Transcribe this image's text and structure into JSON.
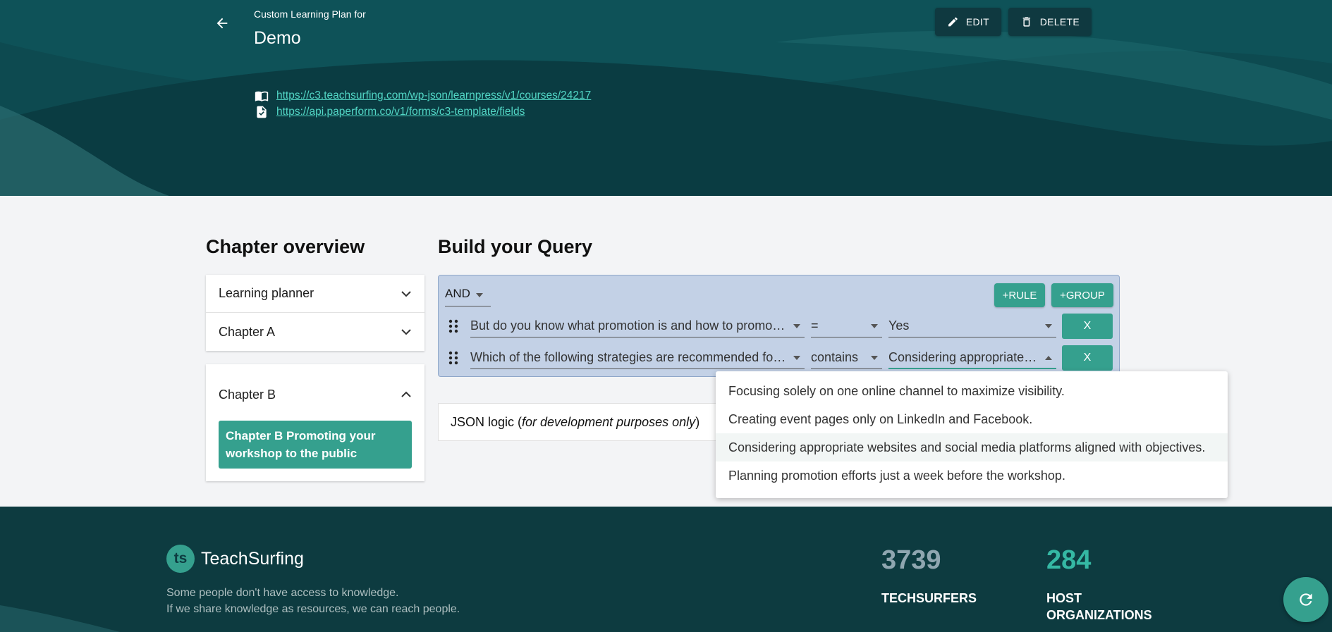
{
  "header": {
    "subtitle": "Custom Learning Plan for",
    "title": "Demo",
    "edit_label": "EDIT",
    "delete_label": "DELETE",
    "links": [
      {
        "icon": "book-icon",
        "text": "https://c3.teachsurfing.com/wp-json/learnpress/v1/courses/24217"
      },
      {
        "icon": "form-check-icon",
        "text": "https://api.paperform.co/v1/forms/c3-template/fields"
      }
    ]
  },
  "overview": {
    "title": "Chapter overview",
    "items": [
      {
        "label": "Learning planner",
        "state": "collapsed"
      },
      {
        "label": "Chapter A",
        "state": "collapsed"
      },
      {
        "label": "Chapter B",
        "state": "expanded"
      }
    ],
    "chapter_b_button": "Chapter B Promoting your workshop to the public"
  },
  "query": {
    "title": "Build your Query",
    "conjunction": "AND",
    "add_rule": "+RULE",
    "add_group": "+GROUP",
    "rules": [
      {
        "field": "But do you know what promotion is and how to promote a workshop?",
        "operator": "=",
        "value": "Yes",
        "remove": "X"
      },
      {
        "field": "Which of the following strategies are recommended for promoting a workshop?",
        "operator": "contains",
        "value": "Considering appropriate websites and social media platforms aligned with objectives.",
        "remove": "X"
      }
    ],
    "json_logic_label": "JSON logic (",
    "json_logic_italic": "for development purposes only",
    "json_logic_close": ")"
  },
  "dropdown": {
    "options": [
      "Focusing solely on one online channel to maximize visibility.",
      "Creating event pages only on LinkedIn and Facebook.",
      "Considering appropriate websites and social media platforms aligned with objectives.",
      "Planning promotion efforts just a week before the workshop."
    ],
    "highlighted_index": 2
  },
  "footer": {
    "logo_mark": "ts",
    "logo_text": "TeachSurfing",
    "tagline_1": "Some people don't have access to knowledge.",
    "tagline_2": "If we share knowledge as resources, we can reach people.",
    "stats": [
      {
        "number": "3739",
        "label": "TECHSURFERS"
      },
      {
        "number": "284",
        "label": "HOST ORGANIZATIONS"
      }
    ]
  },
  "colors": {
    "header_bg": "#0d4a50",
    "accent": "#35a08e",
    "link": "#52d6c5",
    "query_bg": "#c3d1e6",
    "footer_bg": "#0d3b40"
  }
}
